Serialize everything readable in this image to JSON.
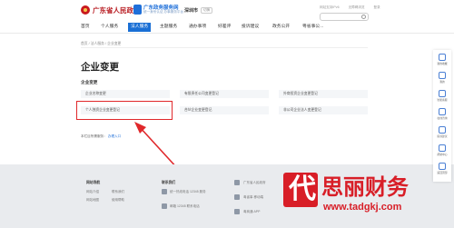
{
  "header": {
    "gov_title": "广东省人民政府",
    "svc_title": "广东政务服务网",
    "svc_sub": "统一身份认证 办事服务平台",
    "city": "深圳市",
    "city_switch": "切换",
    "links": [
      "网站支持IPv6",
      "无障碍浏览",
      "登录"
    ],
    "search_placeholder": ""
  },
  "nav": {
    "items": [
      "首页",
      "个人服务",
      "法人服务",
      "主题服务",
      "通办事项",
      "好差评",
      "投诉建议",
      "政务公开",
      "粤省事公..."
    ],
    "active_index": 2
  },
  "breadcrumb": "首页 / 法人服务 / 企业变更",
  "main": {
    "title": "企业变更",
    "section": "企业变更",
    "items": [
      "企业名称变更",
      "有限责任公司变更登记",
      "外商投资企业变更登记",
      "个人独资企业变更登记",
      "合伙企业变更登记",
      "非公司企业法人变更登记"
    ],
    "highlight_index": 3,
    "note_prefix": "本栏目所需服务：",
    "note_link": "办理入口"
  },
  "footer": {
    "col1_title": "网站导航",
    "col1_links": [
      "网站介绍",
      "联系我们",
      "网站地图",
      "使用帮助"
    ],
    "col2_title": "联系我们",
    "col2_links": [
      "统一热线电话 12345 服务",
      "邮箱 12345  联系电话"
    ],
    "col3_links": [
      "广东省人民政府",
      "粤省事 移动端",
      "粤商通 APP"
    ]
  },
  "floatbar": [
    "我的收藏",
    "我的",
    "智能客服",
    "在线咨询",
    "投诉建议",
    "帮助中心",
    "返回顶部"
  ],
  "watermark": {
    "glyph": "代",
    "brand": "思丽财务",
    "url": "www.tadgkj.com"
  },
  "colors": {
    "accent": "#1a6fd5",
    "highlight": "#e0282b",
    "gov_red": "#b81c22"
  }
}
